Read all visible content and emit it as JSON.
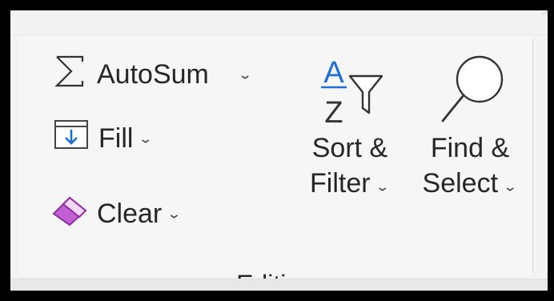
{
  "group": {
    "name": "Editing",
    "autosum": {
      "label": "AutoSum",
      "icon": "sigma-icon"
    },
    "fill": {
      "label": "Fill",
      "icon": "fill-down-icon"
    },
    "clear": {
      "label": "Clear",
      "icon": "eraser-icon"
    },
    "sort_filter": {
      "line1": "Sort &",
      "line2": "Filter",
      "icon": "sort-filter-icon"
    },
    "find_select": {
      "line1": "Find &",
      "line2": "Select",
      "icon": "magnifier-icon"
    }
  },
  "colors": {
    "text": "#262626",
    "sort_a_blue": "#1f6fd0",
    "fill_arrow_blue": "#1f6fd0",
    "eraser_purple": "#b146c2"
  }
}
